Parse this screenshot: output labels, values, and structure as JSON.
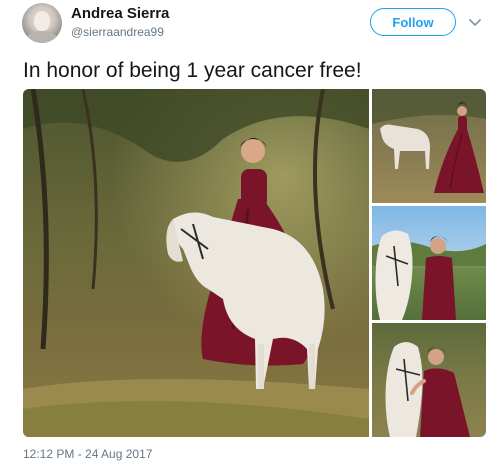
{
  "author": {
    "display_name": "Andrea Sierra",
    "handle": "@sierraandrea99",
    "avatar_icon": "user-avatar"
  },
  "actions": {
    "follow_label": "Follow",
    "more_icon": "chevron-down-icon"
  },
  "tweet": {
    "text": "In honor of being 1 year cancer free!",
    "timestamp": "12:12 PM - 24 Aug 2017"
  },
  "media": {
    "photo_count": 4
  },
  "colors": {
    "accent": "#1da1f2",
    "secondary_text": "#657786",
    "dress": "#7a1428"
  }
}
